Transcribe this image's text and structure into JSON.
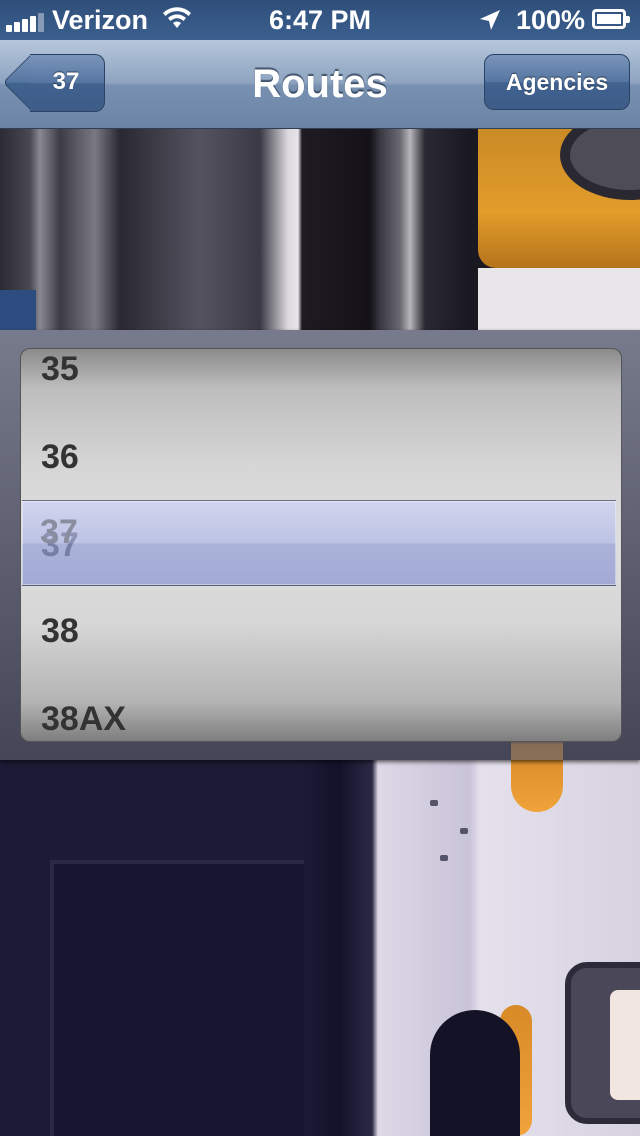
{
  "status_bar": {
    "carrier": "Verizon",
    "time": "6:47 PM",
    "battery": "100%"
  },
  "nav": {
    "back_label": "37",
    "title": "Routes",
    "right_label": "Agencies"
  },
  "picker": {
    "rows": [
      "35",
      "36",
      "37",
      "38",
      "38AX"
    ],
    "selected": "37"
  },
  "colors": {
    "nav_bar": "#7891b1",
    "status_bar": "#3b5f8e",
    "selection_band": "#b0b7e6"
  },
  "icons": [
    "signal-bars-icon",
    "wifi-icon",
    "location-arrow-icon",
    "battery-icon",
    "back-chevron-icon"
  ]
}
